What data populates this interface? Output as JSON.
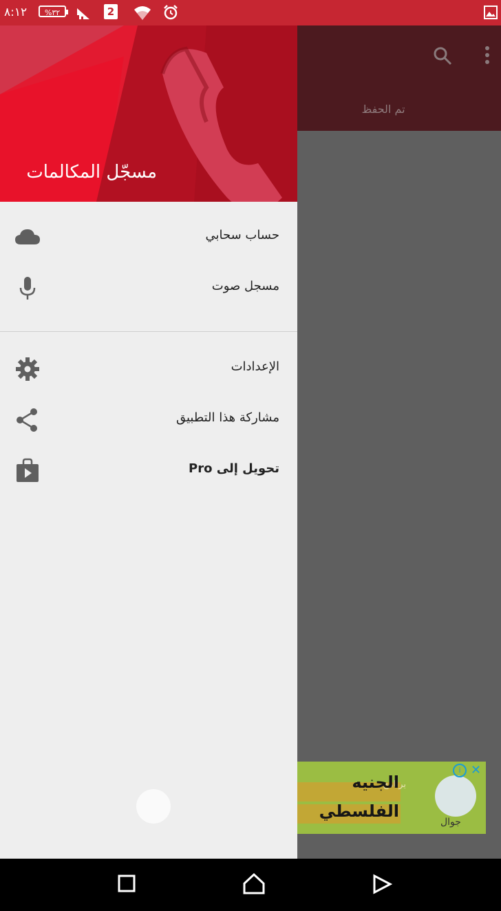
{
  "status_bar": {
    "time": "٨:١٢",
    "battery": "%٣٢",
    "sim_slot": "2",
    "icons": [
      "battery-icon",
      "signal-icon",
      "sim-icon",
      "wifi-icon",
      "alarm-icon",
      "image-notification-icon"
    ]
  },
  "app_bar": {
    "tab_saved": "تم الحفظ",
    "icons": [
      "search-icon",
      "more-vert-icon"
    ]
  },
  "drawer": {
    "title": "مسجّل المكالمات",
    "items": [
      {
        "label": "حساب سحابي",
        "icon": "cloud-icon"
      },
      {
        "label": "مسجل صوت",
        "icon": "mic-icon"
      },
      {
        "label": "الإعدادات",
        "icon": "gear-icon"
      },
      {
        "label": "مشاركة هذا التطبيق",
        "icon": "share-icon"
      },
      {
        "label": "تحويل إلى Pro",
        "icon": "shop-icon"
      }
    ]
  },
  "ad": {
    "small_text": "برنامج",
    "line1": "الجنيه",
    "line2": "الفلسطي",
    "brand": "جوال"
  },
  "nav_bar": {
    "icons": [
      "recents-icon",
      "home-icon",
      "back-icon"
    ]
  },
  "colors": {
    "status_bar": "#c62632",
    "drawer_header": "#a50e1e",
    "drawer_bg": "#eeeeee",
    "scrim": "#5f5f5f"
  }
}
